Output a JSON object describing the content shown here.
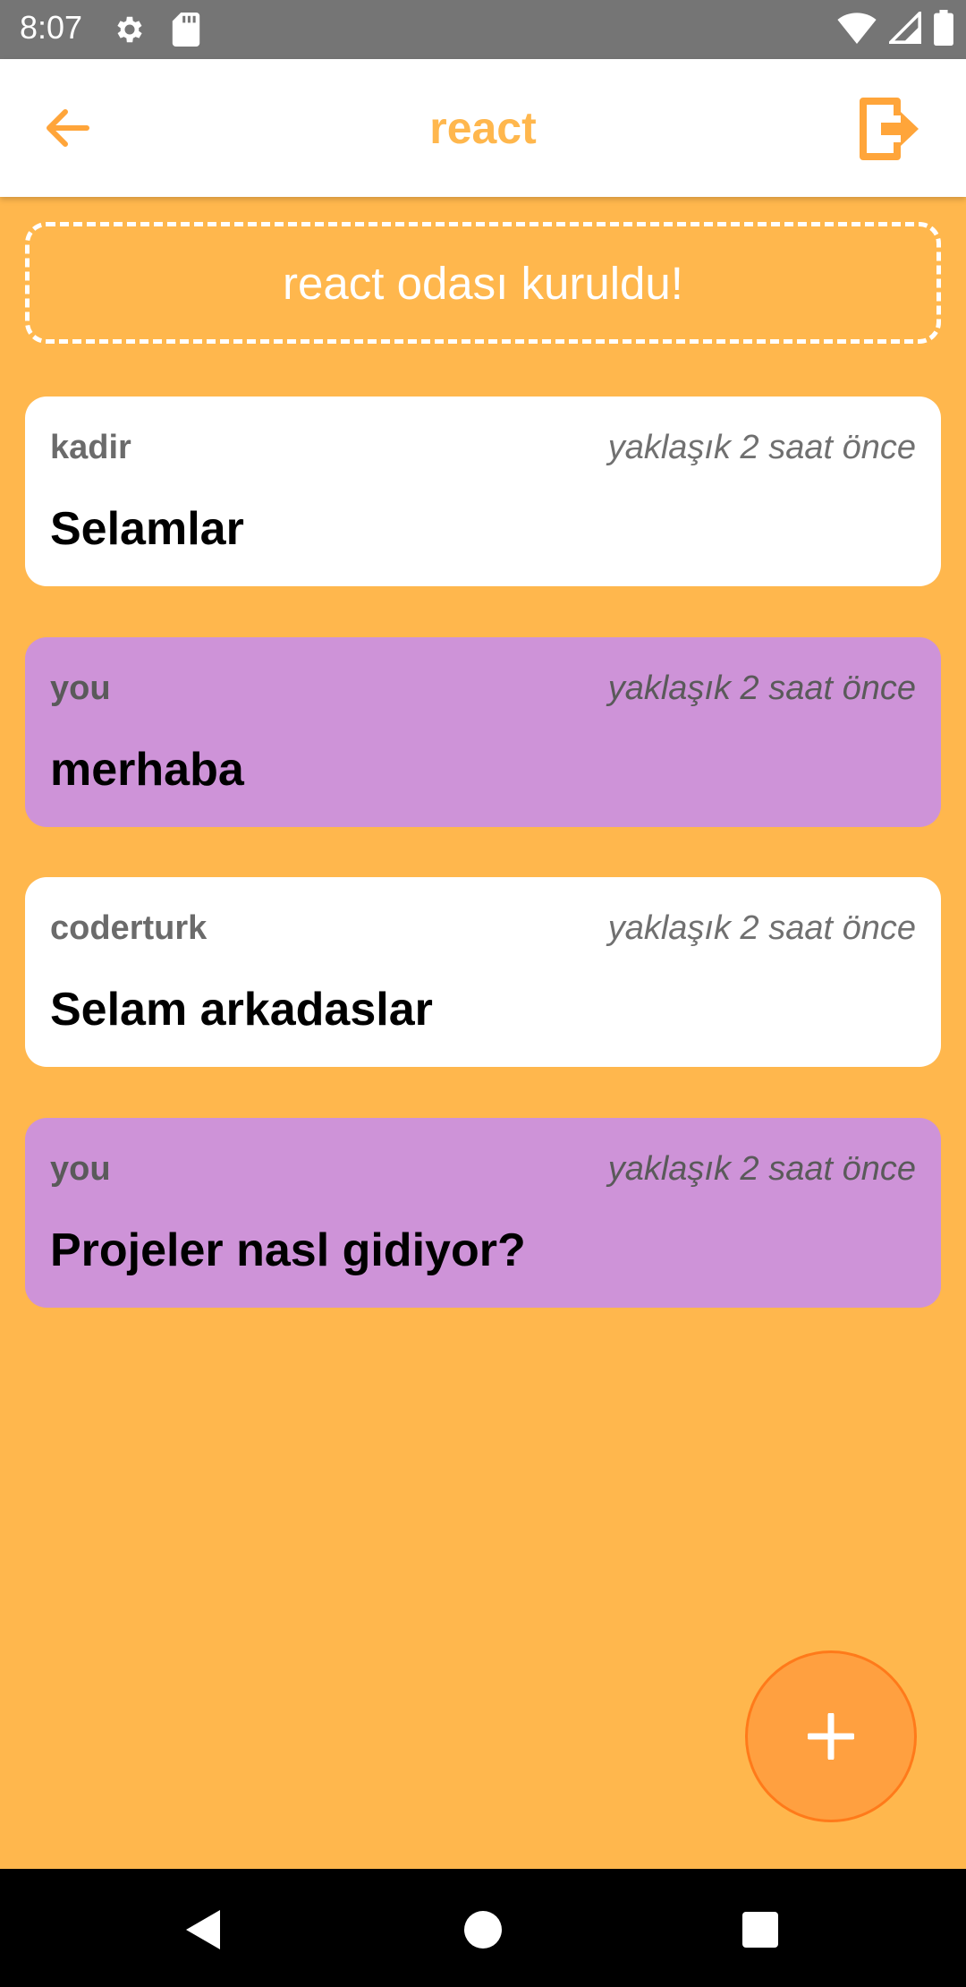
{
  "status_bar": {
    "time": "8:07",
    "icons": [
      "gear-icon",
      "sd-card-icon",
      "wifi-icon",
      "signal-icon",
      "battery-icon"
    ]
  },
  "app_bar": {
    "title": "react",
    "back_icon": "arrow-left-icon",
    "logout_icon": "logout-icon",
    "accent_color": "#FFB74D"
  },
  "banner": {
    "text": "react odası kuruldu!"
  },
  "messages": [
    {
      "user": "kadir",
      "time": "yaklaşık 2 saat önce",
      "text": "Selamlar",
      "mine": false
    },
    {
      "user": "you",
      "time": "yaklaşık 2 saat önce",
      "text": "merhaba",
      "mine": true
    },
    {
      "user": "coderturk",
      "time": "yaklaşık 2 saat önce",
      "text": "Selam arkadaslar",
      "mine": false
    },
    {
      "user": "you",
      "time": "yaklaşık 2 saat önce",
      "text": "Projeler nasl gidiyor?",
      "mine": true
    }
  ],
  "fab": {
    "icon": "plus-icon"
  },
  "colors": {
    "background": "#FFB74D",
    "own_message": "#CE93D8",
    "other_message": "#FFFFFF",
    "fab": "#FFA040"
  },
  "nav_bar": {
    "icons": [
      "back-triangle-icon",
      "home-circle-icon",
      "recents-square-icon"
    ]
  }
}
